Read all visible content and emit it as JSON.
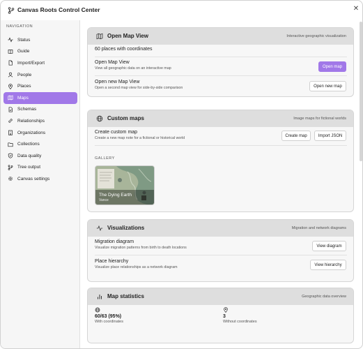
{
  "window": {
    "title": "Canvas Roots Control Center"
  },
  "sidebar": {
    "header": "NAVIGATION",
    "items": [
      {
        "label": "Status",
        "icon": "activity-icon"
      },
      {
        "label": "Guide",
        "icon": "book-icon"
      },
      {
        "label": "Import/Export",
        "icon": "file-icon"
      },
      {
        "label": "People",
        "icon": "user-icon"
      },
      {
        "label": "Places",
        "icon": "map-pin-icon"
      },
      {
        "label": "Maps",
        "icon": "map-icon",
        "active": true
      },
      {
        "label": "Schemas",
        "icon": "file-check-icon"
      },
      {
        "label": "Relationships",
        "icon": "link-icon"
      },
      {
        "label": "Organizations",
        "icon": "building-icon"
      },
      {
        "label": "Collections",
        "icon": "folder-icon"
      },
      {
        "label": "Data quality",
        "icon": "shield-check-icon"
      },
      {
        "label": "Tree output",
        "icon": "git-branch-icon"
      },
      {
        "label": "Canvas settings",
        "icon": "gear-icon"
      }
    ]
  },
  "open_map_view": {
    "title": "Open Map View",
    "subtitle": "Interactive geographic visualization",
    "summary": "60 places with coordinates",
    "rows": [
      {
        "title": "Open Map View",
        "desc": "View all geographic data on an interactive map",
        "button": "Open map"
      },
      {
        "title": "Open new Map View",
        "desc": "Open a second map view for side-by-side comparison",
        "button": "Open new map"
      }
    ]
  },
  "custom_maps": {
    "title": "Custom maps",
    "subtitle": "Image maps for fictional worlds",
    "create": {
      "title": "Create custom map",
      "desc": "Create a new map note for a fictional or historical world",
      "button_create": "Create map",
      "button_import": "Import JSON"
    },
    "gallery_label": "GALLERY",
    "gallery": [
      {
        "title": "The Dying Earth",
        "sub": "Vance"
      }
    ]
  },
  "visualizations": {
    "title": "Visualizations",
    "subtitle": "Migration and network diagrams",
    "rows": [
      {
        "title": "Migration diagram",
        "desc": "Visualize migration patterns from birth to death locations",
        "button": "View diagram"
      },
      {
        "title": "Place hierarchy",
        "desc": "Visualize place relationships as a network diagram",
        "button": "View hierarchy"
      }
    ]
  },
  "map_statistics": {
    "title": "Map statistics",
    "subtitle": "Geographic data overview",
    "stats": [
      {
        "value": "60/63 (95%)",
        "label": "With coordinates",
        "icon": "globe-icon"
      },
      {
        "value": "3",
        "label": "Without coordinates",
        "icon": "map-pin-icon"
      }
    ]
  },
  "colors": {
    "accent": "#a178e8",
    "card_header": "#dedede"
  }
}
